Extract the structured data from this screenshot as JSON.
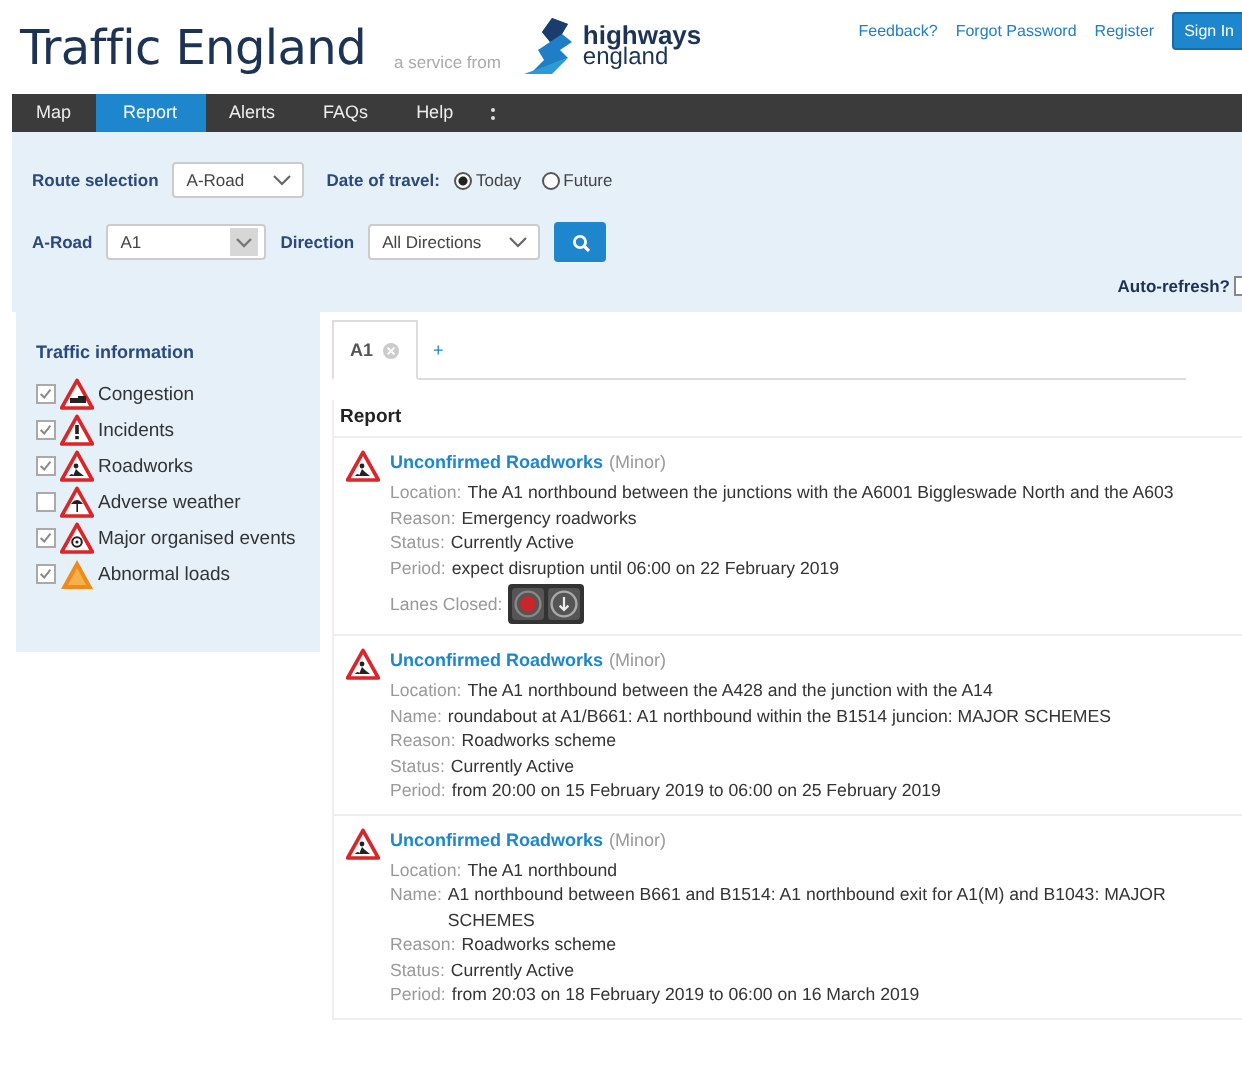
{
  "header": {
    "title": "Traffic England",
    "tagline": "a service from",
    "logo_lines": [
      "highways",
      "england"
    ],
    "links": [
      "Feedback?",
      "Forgot Password",
      "Register"
    ],
    "sign_in": "Sign In"
  },
  "nav": [
    {
      "label": "Map",
      "selected": false
    },
    {
      "label": "Report",
      "selected": true
    },
    {
      "label": "Alerts",
      "selected": false
    },
    {
      "label": "FAQs",
      "selected": false
    },
    {
      "label": "Help",
      "selected": false
    }
  ],
  "filters": {
    "route_label": "Route selection",
    "route_value": "A-Road",
    "date_label": "Date of travel:",
    "date_options": [
      {
        "label": "Today",
        "selected": true
      },
      {
        "label": "Future",
        "selected": false
      }
    ],
    "road_label": "A-Road",
    "road_value": "A1",
    "direction_label": "Direction",
    "direction_value": "All Directions",
    "auto_refresh": {
      "label": "Auto-refresh?",
      "checked": false
    }
  },
  "sidebar": {
    "heading": "Traffic information",
    "items": [
      {
        "label": "Congestion",
        "checked": true,
        "kind": "congestion"
      },
      {
        "label": "Incidents",
        "checked": true,
        "kind": "incident"
      },
      {
        "label": "Roadworks",
        "checked": true,
        "kind": "roadworks"
      },
      {
        "label": "Adverse weather",
        "checked": false,
        "kind": "weather"
      },
      {
        "label": "Major organised events",
        "checked": true,
        "kind": "event"
      },
      {
        "label": "Abnormal loads",
        "checked": true,
        "kind": "abnormal"
      }
    ]
  },
  "tabs": [
    {
      "label": "A1",
      "selected": true,
      "closable": true
    },
    {
      "label": "+",
      "selected": false,
      "closable": false
    }
  ],
  "report": {
    "heading": "Report",
    "events": [
      {
        "kind": "roadworks",
        "title": "Unconfirmed Roadworks",
        "severity": "(Minor)",
        "fields": [
          {
            "label": "Location:",
            "value": "The A1 northbound between the junctions with the A6001 Biggleswade North and the A603"
          },
          {
            "label": "Reason:",
            "value": "Emergency roadworks"
          },
          {
            "label": "Status:",
            "value": "Currently Active"
          },
          {
            "label": "Period:",
            "value": "expect disruption until 06:00 on 22 February 2019"
          }
        ],
        "lanes_label": "Lanes Closed:",
        "lanes": [
          {
            "closed": true
          },
          {
            "closed": false
          }
        ]
      },
      {
        "kind": "roadworks",
        "title": "Unconfirmed Roadworks",
        "severity": "(Minor)",
        "fields": [
          {
            "label": "Location:",
            "value": "The A1 northbound between the A428 and the junction with the A14"
          },
          {
            "label": "Name:",
            "value": "roundabout at A1/B661: A1 northbound within the B1514 juncion: MAJOR SCHEMES"
          },
          {
            "label": "Reason:",
            "value": "Roadworks scheme"
          },
          {
            "label": "Status:",
            "value": "Currently Active"
          },
          {
            "label": "Period:",
            "value": "from 20:00 on 15 February 2019 to 06:00 on 25 February 2019"
          }
        ]
      },
      {
        "kind": "roadworks",
        "title": "Unconfirmed Roadworks",
        "severity": "(Minor)",
        "fields": [
          {
            "label": "Location:",
            "value": "The A1 northbound"
          },
          {
            "label": "Name:",
            "value": "A1 northbound between B661 and B1514: A1 northbound exit for A1(M) and B1043: MAJOR SCHEMES"
          },
          {
            "label": "Reason:",
            "value": "Roadworks scheme"
          },
          {
            "label": "Status:",
            "value": "Currently Active"
          },
          {
            "label": "Period:",
            "value": "from 20:03 on 18 February 2019 to 06:00 on 16 March 2019"
          }
        ]
      }
    ]
  }
}
